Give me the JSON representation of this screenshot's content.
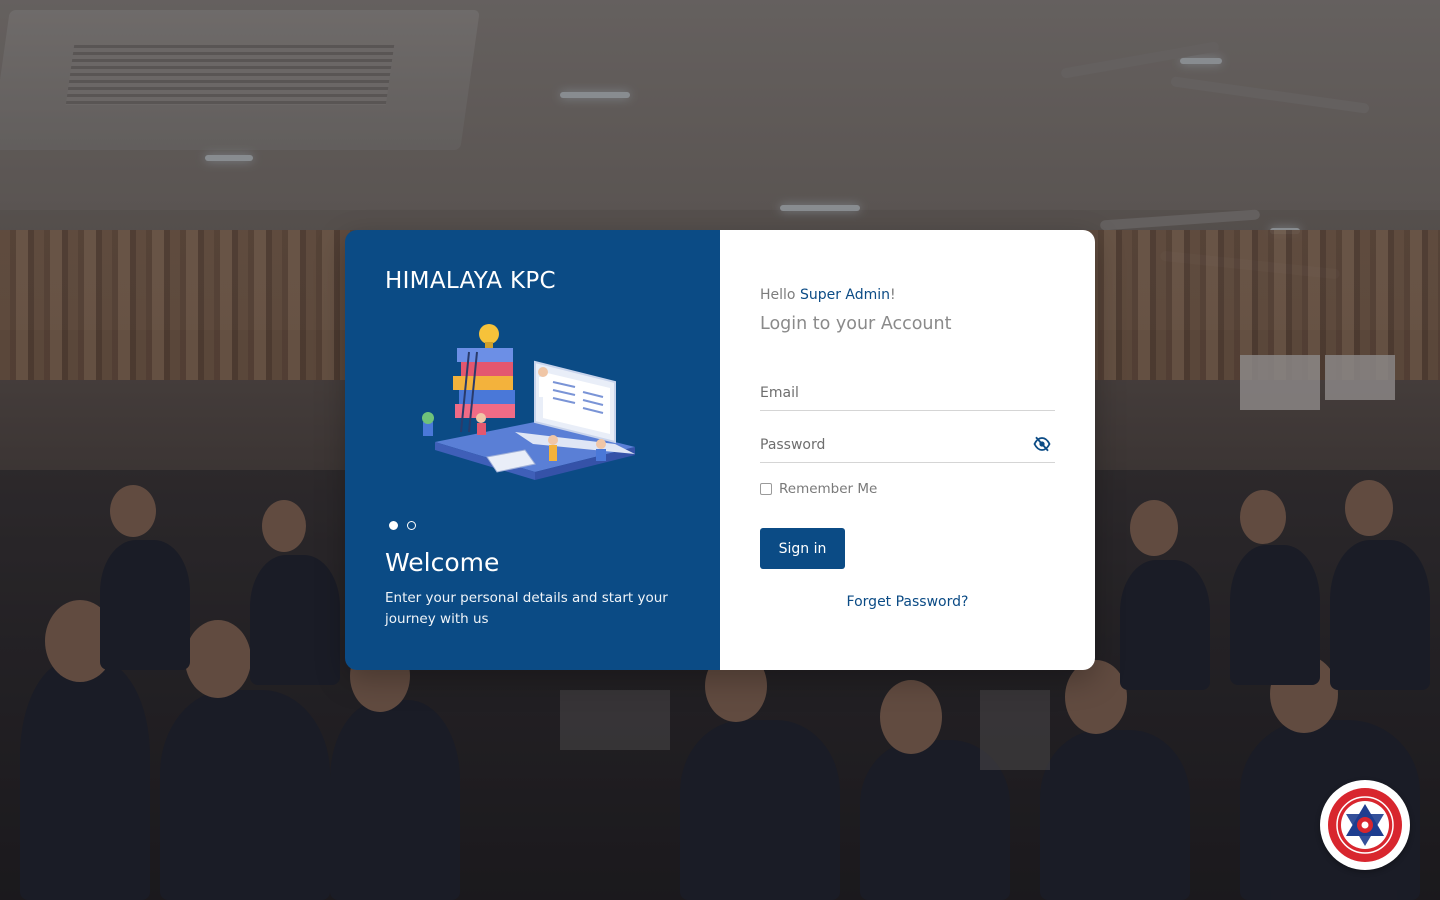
{
  "brand": {
    "name": "HIMALAYA KPC"
  },
  "carousel": {
    "slides": [
      "slide-1",
      "slide-2"
    ],
    "active_index": 0,
    "heading": "Welcome",
    "text": "Enter your personal details and start your journey with us"
  },
  "login": {
    "greeting_prefix": "Hello",
    "greeting_name": "Super Admin",
    "greeting_suffix": "!",
    "title": "Login to your Account",
    "email_placeholder": "Email",
    "email_value": "",
    "password_placeholder": "Password",
    "password_value": "",
    "remember_label": "Remember Me",
    "remember_checked": false,
    "submit_label": "Sign in",
    "forgot_label": "Forget Password?"
  },
  "colors": {
    "primary": "#0b4b85",
    "panel_bg": "#ffffff",
    "muted_text": "#7d7d7d"
  },
  "icons": {
    "password_toggle": "eye-slash-icon",
    "university_badge": "university-seal-logo"
  }
}
